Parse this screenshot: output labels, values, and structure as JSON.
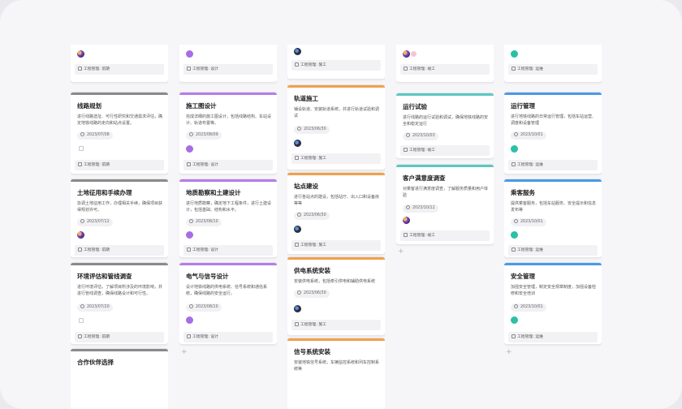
{
  "columns": [
    {
      "id": "c1",
      "cards": [
        {
          "title": "",
          "desc": "",
          "date": "",
          "tag": "工程管理: 前期"
        },
        {
          "title": "线路规划",
          "desc": "进行线路选址、可行性研究和交通需求评估，确定地铁线路的走向和站点设置。",
          "date": "2023/07/08",
          "tag": "工程管理: 前期"
        },
        {
          "title": "土地征用和手续办理",
          "desc": "协调土地征用工作，办理相关手续，确保项目获得规划许可。",
          "date": "2023/07/12",
          "tag": "工程管理: 前期"
        },
        {
          "title": "环境评估和管线调查",
          "desc": "进行环境评估，了解项目所涉及的环境影响，并进行管线调查，确保线路设计和可行性。",
          "date": "2023/07/20",
          "tag": "工程管理: 前期"
        },
        {
          "title": "合作伙伴选择",
          "desc": "",
          "date": "",
          "tag": ""
        }
      ]
    },
    {
      "id": "c2",
      "cards": [
        {
          "title": "",
          "desc": "",
          "date": "",
          "tag": "工程管理: 设计"
        },
        {
          "title": "施工图设计",
          "desc": "完成详细的施工图设计，包括线路结构、车站设计、轨道布置等。",
          "date": "2023/08/09",
          "tag": "工程管理: 设计"
        },
        {
          "title": "地质勘察和土建设计",
          "desc": "进行地质勘察，确定地下工程条件，进行土建设计，包括基础、结构和水平。",
          "date": "2023/08/10",
          "tag": "工程管理: 设计"
        },
        {
          "title": "电气与信号设计",
          "desc": "设计地铁线路的供电系统、信号系统和通信系统，确保线路的安全运行。",
          "date": "2023/08/10",
          "tag": "工程管理: 设计"
        }
      ]
    },
    {
      "id": "c3",
      "cards": [
        {
          "title": "",
          "desc": "",
          "date": "",
          "tag": "工程管理: 施工"
        },
        {
          "title": "轨道施工",
          "desc": "铺设轨道、安装轨道系统，并进行轨道试验和调试",
          "date": "2023/06/30",
          "tag": "工程管理: 施工"
        },
        {
          "title": "站点建设",
          "desc": "进行各站点的建设，包括站厅、出入口和设备房等等",
          "date": "2023/06/30",
          "tag": "工程管理: 施工"
        },
        {
          "title": "供电系统安装",
          "desc": "安装供电系统，包括牵引供电和辅助供电系统",
          "date": "2023/06/30",
          "tag": "工程管理: 施工"
        },
        {
          "title": "信号系统安装",
          "desc": "安装地铁信号系统，车辆监控系统和列车控制系统等",
          "date": "",
          "tag": ""
        }
      ]
    },
    {
      "id": "c4",
      "cards": [
        {
          "title": "",
          "desc": "",
          "date": "",
          "tag": "工程管理: 竣工"
        },
        {
          "title": "运行试验",
          "desc": "进行线路的运行试验和调试，确保地铁线路的安全和稳定运行",
          "date": "2023/10/03",
          "tag": "工程管理: 竣工"
        },
        {
          "title": "客户满意度调查",
          "desc": "对乘客进行满意度调查，了解服务质量和用户体验",
          "date": "2023/10/12",
          "tag": "工程管理: 竣工"
        }
      ]
    },
    {
      "id": "c5",
      "cards": [
        {
          "title": "",
          "desc": "",
          "date": "",
          "tag": "工程管理: 运维"
        },
        {
          "title": "运行管理",
          "desc": "进行地铁线路的日常运行管理，包括车站运营、调度和设备管理",
          "date": "2023/10/01",
          "tag": "工程管理: 运维"
        },
        {
          "title": "乘客服务",
          "desc": "提供乘客服务，包括车站服务、安全提示和信息发布等",
          "date": "2023/10/01",
          "tag": "工程管理: 运维"
        },
        {
          "title": "安全管理",
          "desc": "加强安全管理，制定安全规章制度，加强设备检修和安全培训",
          "date": "2023/10/01",
          "tag": "工程管理: 运维"
        }
      ]
    }
  ],
  "add_symbol": "+",
  "colors": {
    "gray": "#8a8a8a",
    "purple": "#b57de8",
    "orange": "#f0a04b",
    "teal": "#5cc7c0",
    "blue": "#4a9ae8"
  },
  "icons": {
    "date": "calendar-icon",
    "tag": "folder-icon",
    "checkbox": "checkbox-icon",
    "add": "plus-icon"
  }
}
